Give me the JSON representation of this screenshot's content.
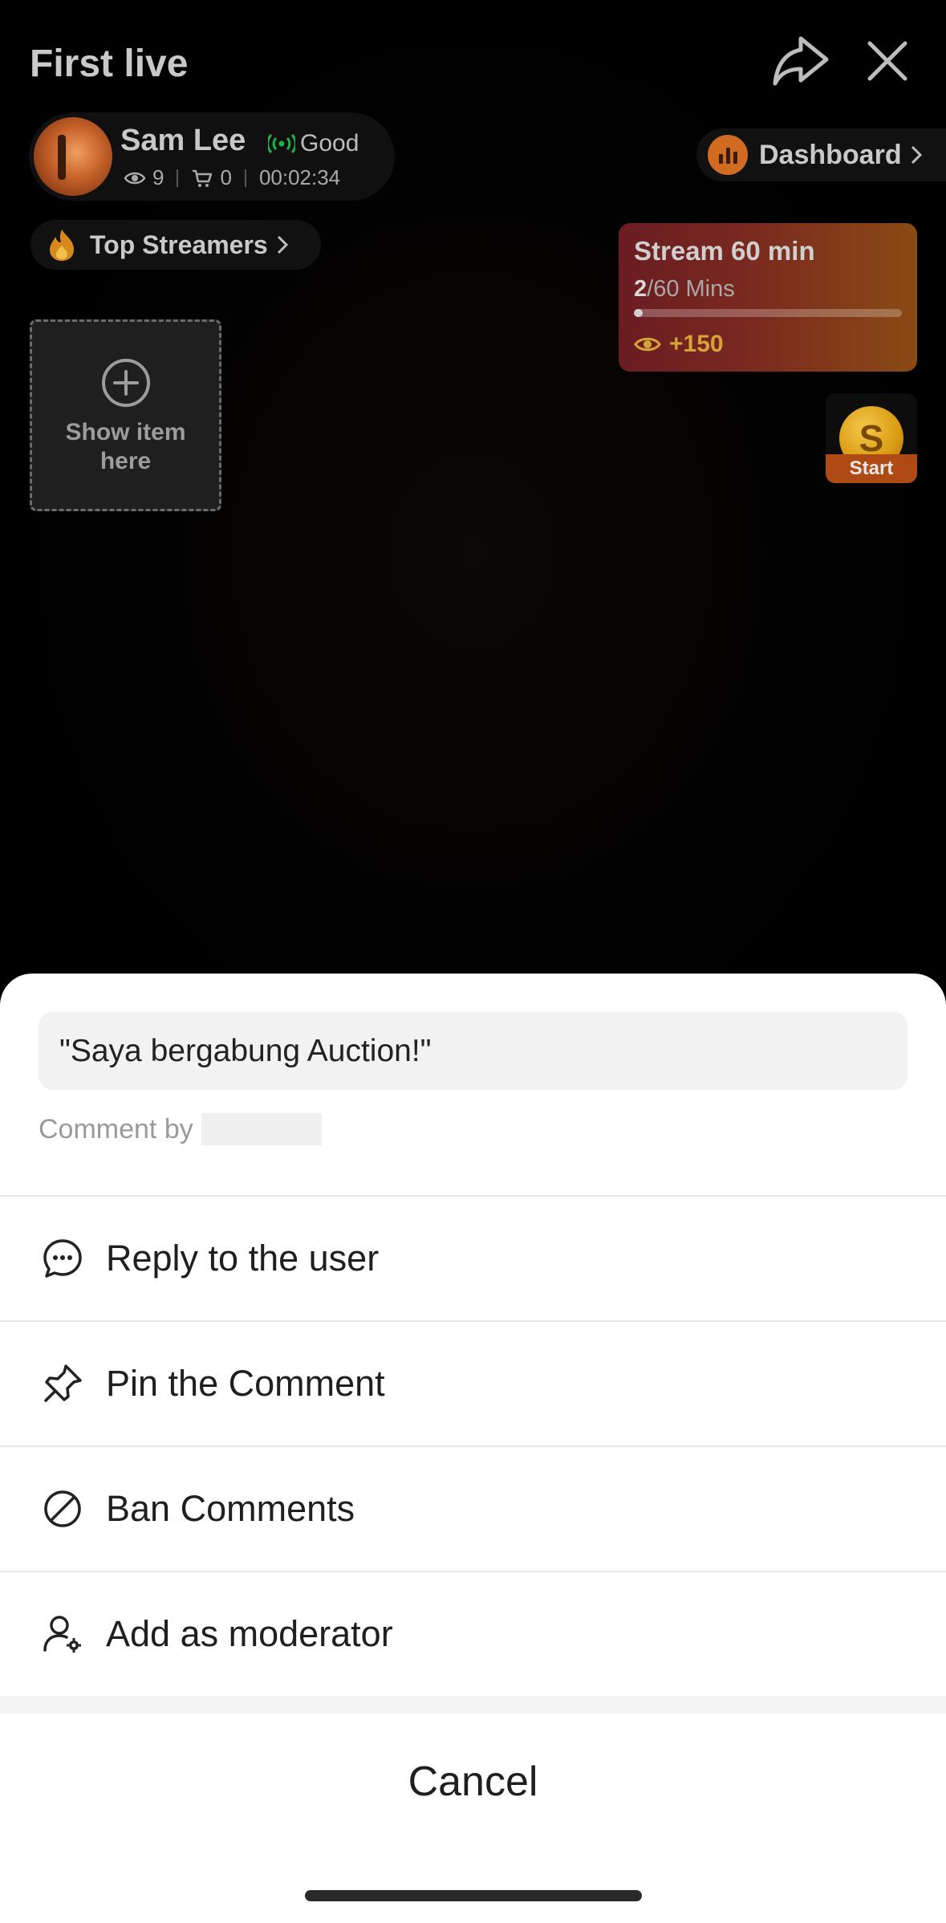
{
  "header": {
    "title": "First live"
  },
  "streamer": {
    "name": "Sam Lee",
    "connection": "Good",
    "viewers": "9",
    "cart": "0",
    "duration": "00:02:34"
  },
  "dashboard": {
    "label": "Dashboard"
  },
  "top_streamers": {
    "label": "Top Streamers"
  },
  "show_item": {
    "label": "Show item here"
  },
  "mission": {
    "title": "Stream 60 min",
    "progress_current": "2",
    "progress_total": "/60 Mins",
    "progress_fraction": 0.033,
    "reward": "+150"
  },
  "coin": {
    "symbol": "S",
    "label": "Start"
  },
  "sheet": {
    "quote": "\"Saya bergabung Auction!\"",
    "comment_by": "Comment by",
    "menu": [
      {
        "label": "Reply to the user",
        "icon": "chat-bubble-icon"
      },
      {
        "label": "Pin the Comment",
        "icon": "pin-icon"
      },
      {
        "label": "Ban Comments",
        "icon": "ban-icon"
      },
      {
        "label": "Add as moderator",
        "icon": "user-settings-icon"
      }
    ],
    "cancel": "Cancel"
  },
  "colors": {
    "accent_orange": "#d26b22",
    "signal_green": "#22b04a",
    "reward_gold": "#d4a43a"
  }
}
